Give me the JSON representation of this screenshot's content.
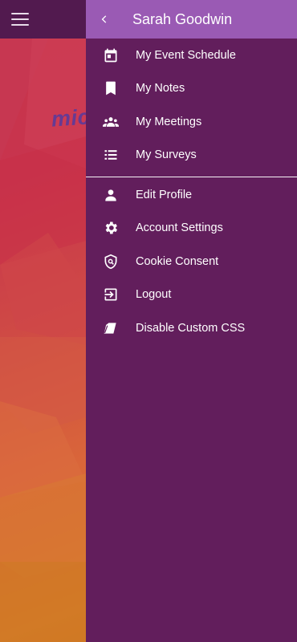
{
  "header": {
    "title": "Sarah Goodwin",
    "back_icon": "chevron-left-icon"
  },
  "background": {
    "menu_icon": "hamburger-menu-icon",
    "logo_fragment": "mic"
  },
  "menu": {
    "primary": [
      {
        "label": "My Event Schedule",
        "icon": "calendar-icon"
      },
      {
        "label": "My Notes",
        "icon": "bookmark-icon"
      },
      {
        "label": "My Meetings",
        "icon": "people-icon"
      },
      {
        "label": "My Surveys",
        "icon": "list-icon"
      }
    ],
    "secondary": [
      {
        "label": "Edit Profile",
        "icon": "person-icon"
      },
      {
        "label": "Account Settings",
        "icon": "gear-icon"
      },
      {
        "label": "Cookie Consent",
        "icon": "shield-search-icon"
      },
      {
        "label": "Logout",
        "icon": "logout-icon"
      },
      {
        "label": "Disable Custom CSS",
        "icon": "paint-eraser-icon"
      }
    ]
  },
  "colors": {
    "drawer_bg": "#621e5c",
    "drawer_header_bg": "#9a5ab4",
    "app_header_bg": "#521a4f"
  }
}
